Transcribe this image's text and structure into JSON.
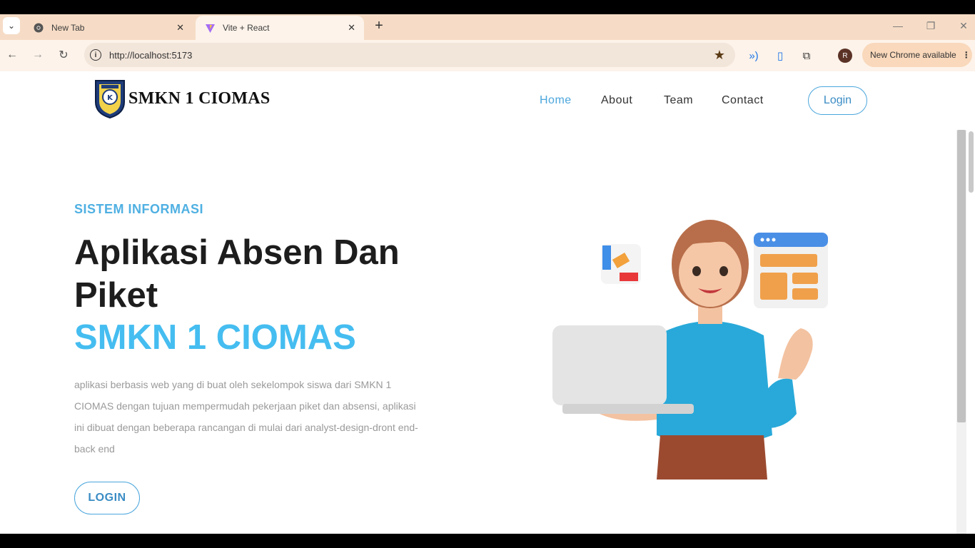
{
  "browser": {
    "tabs": [
      {
        "title": "New Tab",
        "favicon": "chrome-icon",
        "active": false
      },
      {
        "title": "Vite + React",
        "favicon": "vite-icon",
        "active": true
      }
    ],
    "url": "http://localhost:5173",
    "profile_initial": "R",
    "update_label": "New Chrome available",
    "accent_color": "#f9e4d2"
  },
  "site": {
    "logo_text": "SMKN 1 CIOMAS",
    "nav": [
      {
        "label": "Home",
        "active": true
      },
      {
        "label": "About",
        "active": false
      },
      {
        "label": "Team",
        "active": false
      },
      {
        "label": "Contact",
        "active": false
      }
    ],
    "login_label": "Login",
    "brand_color": "#4ba6dd"
  },
  "hero": {
    "eyebrow": "SISTEM INFORMASI",
    "headline": "Aplikasi Absen Dan Piket",
    "headline_accent": "SMKN 1 CIOMAS",
    "description": "aplikasi berbasis web yang di buat oleh sekelompok siswa dari SMKN 1 CIOMAS dengan tujuan mempermudah pekerjaan piket dan absensi, aplikasi ini dibuat dengan beberapa rancangan di mulai dari analyst-design-dront end- back end",
    "cta_label": "LOGIN",
    "accent_color": "#45bdf0"
  }
}
